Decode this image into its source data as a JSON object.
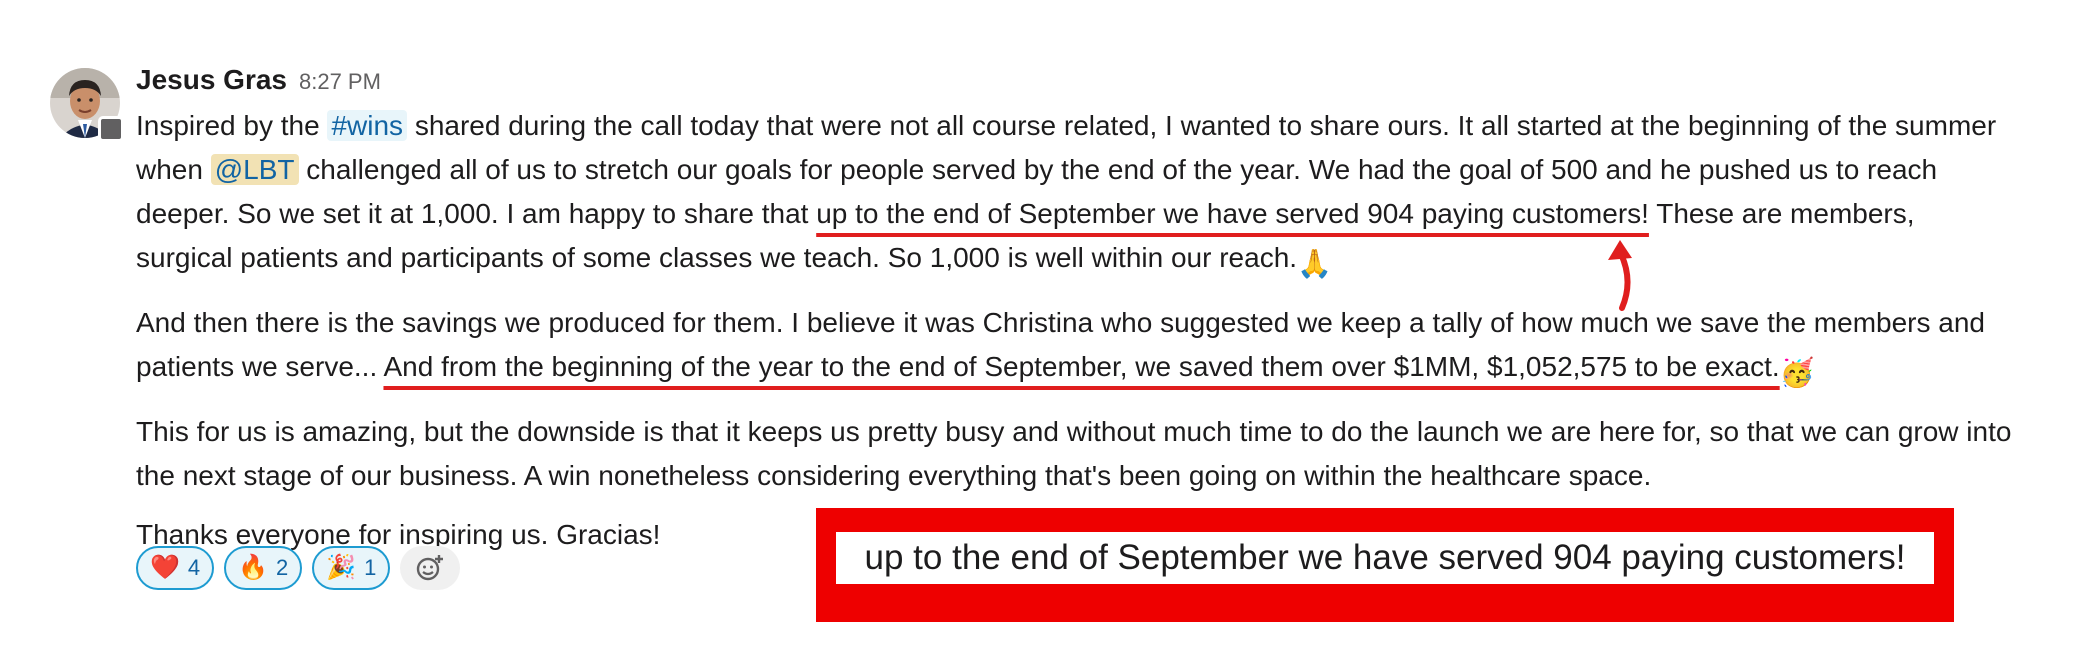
{
  "message": {
    "author": "Jesus Gras",
    "time": "8:27 PM",
    "p1": {
      "t1": "Inspired by the ",
      "channel": "#wins",
      "t2": " shared during the call today that were not all course related, I wanted to share ours. It all started at the beginning of the summer when ",
      "mention": "@LBT",
      "t3": " challenged all of us to stretch our goals for people served by the end of the year. We had the goal of 500 and he pushed us to reach deeper. So we set it at 1,000. I am happy to share that ",
      "highlight": "up to the end of September we have served 904 paying customers!",
      "t4": " These are members, surgical patients and participants of some classes we teach. So 1,000 is well within our reach.",
      "emoji": "🙏"
    },
    "p2": {
      "t1": "And then there is the savings we produced for them. I believe it was Christina who suggested we keep a tally of how much we save the members and patients we serve... ",
      "highlight": "And from the beginning of the year to the end of September, we saved them over $1MM, $1,052,575 to be exact.",
      "emoji": "🥳"
    },
    "p3": "This for us is amazing, but the downside is that it keeps us pretty busy and without much time to do the launch we are here for, so that we can grow into the next stage of our business. A win nonetheless considering everything that's been going on within the healthcare space.",
    "p4": "Thanks everyone for inspiring us. Gracias!"
  },
  "reactions": [
    {
      "icon": "heart-icon",
      "glyph": "❤️",
      "count": "4"
    },
    {
      "icon": "fire-icon",
      "glyph": "🔥",
      "count": "2"
    },
    {
      "icon": "party-popper-icon",
      "glyph": "🎉",
      "count": "1"
    }
  ],
  "callout": {
    "text": "up to the end of September we have served 904 paying customers!"
  },
  "colors": {
    "annotation_red": "#e01e1e",
    "reaction_border": "#1d9bd1",
    "link_blue": "#1264a3"
  }
}
